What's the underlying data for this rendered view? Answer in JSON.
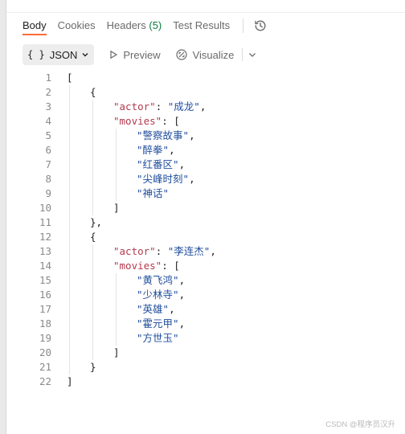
{
  "tabs": [
    {
      "label": "Body",
      "count": null,
      "active": true
    },
    {
      "label": "Cookies",
      "count": null,
      "active": false
    },
    {
      "label": "Headers",
      "count": "(5)",
      "active": false
    },
    {
      "label": "Test Results",
      "count": null,
      "active": false
    }
  ],
  "history_icon": "history-icon",
  "toolbar": {
    "format_braces": "{ }",
    "format_label": "JSON",
    "preview_label": "Preview",
    "visualize_label": "Visualize"
  },
  "editor": {
    "lines": [
      {
        "n": "1",
        "indent": 0,
        "parts": [
          {
            "t": "[",
            "c": "p"
          }
        ]
      },
      {
        "n": "2",
        "indent": 1,
        "parts": [
          {
            "t": "{",
            "c": "p"
          }
        ]
      },
      {
        "n": "3",
        "indent": 2,
        "parts": [
          {
            "t": "\"actor\"",
            "c": "k"
          },
          {
            "t": ": ",
            "c": "p"
          },
          {
            "t": "\"成龙\"",
            "c": "s"
          },
          {
            "t": ",",
            "c": "p"
          }
        ]
      },
      {
        "n": "4",
        "indent": 2,
        "parts": [
          {
            "t": "\"movies\"",
            "c": "k"
          },
          {
            "t": ": [",
            "c": "p"
          }
        ]
      },
      {
        "n": "5",
        "indent": 3,
        "parts": [
          {
            "t": "\"警察故事\"",
            "c": "s"
          },
          {
            "t": ",",
            "c": "p"
          }
        ]
      },
      {
        "n": "6",
        "indent": 3,
        "parts": [
          {
            "t": "\"醉拳\"",
            "c": "s"
          },
          {
            "t": ",",
            "c": "p"
          }
        ]
      },
      {
        "n": "7",
        "indent": 3,
        "parts": [
          {
            "t": "\"红番区\"",
            "c": "s"
          },
          {
            "t": ",",
            "c": "p"
          }
        ]
      },
      {
        "n": "8",
        "indent": 3,
        "parts": [
          {
            "t": "\"尖峰时刻\"",
            "c": "s"
          },
          {
            "t": ",",
            "c": "p"
          }
        ]
      },
      {
        "n": "9",
        "indent": 3,
        "parts": [
          {
            "t": "\"神话\"",
            "c": "s"
          }
        ]
      },
      {
        "n": "10",
        "indent": 2,
        "parts": [
          {
            "t": "]",
            "c": "p"
          }
        ]
      },
      {
        "n": "11",
        "indent": 1,
        "parts": [
          {
            "t": "},",
            "c": "p"
          }
        ]
      },
      {
        "n": "12",
        "indent": 1,
        "parts": [
          {
            "t": "{",
            "c": "p"
          }
        ]
      },
      {
        "n": "13",
        "indent": 2,
        "parts": [
          {
            "t": "\"actor\"",
            "c": "k"
          },
          {
            "t": ": ",
            "c": "p"
          },
          {
            "t": "\"李连杰\"",
            "c": "s"
          },
          {
            "t": ",",
            "c": "p"
          }
        ]
      },
      {
        "n": "14",
        "indent": 2,
        "parts": [
          {
            "t": "\"movies\"",
            "c": "k"
          },
          {
            "t": ": [",
            "c": "p"
          }
        ]
      },
      {
        "n": "15",
        "indent": 3,
        "parts": [
          {
            "t": "\"黄飞鸿\"",
            "c": "s"
          },
          {
            "t": ",",
            "c": "p"
          }
        ]
      },
      {
        "n": "16",
        "indent": 3,
        "parts": [
          {
            "t": "\"少林寺\"",
            "c": "s"
          },
          {
            "t": ",",
            "c": "p"
          }
        ]
      },
      {
        "n": "17",
        "indent": 3,
        "parts": [
          {
            "t": "\"英雄\"",
            "c": "s"
          },
          {
            "t": ",",
            "c": "p"
          }
        ]
      },
      {
        "n": "18",
        "indent": 3,
        "parts": [
          {
            "t": "\"霍元甲\"",
            "c": "s"
          },
          {
            "t": ",",
            "c": "p"
          }
        ]
      },
      {
        "n": "19",
        "indent": 3,
        "parts": [
          {
            "t": "\"方世玉\"",
            "c": "s"
          }
        ]
      },
      {
        "n": "20",
        "indent": 2,
        "parts": [
          {
            "t": "]",
            "c": "p"
          }
        ]
      },
      {
        "n": "21",
        "indent": 1,
        "parts": [
          {
            "t": "}",
            "c": "p"
          }
        ]
      },
      {
        "n": "22",
        "indent": 0,
        "parts": [
          {
            "t": "]",
            "c": "p"
          }
        ]
      }
    ]
  },
  "watermark": "CSDN @程序员汉升",
  "colors": {
    "accent": "#ff6c37",
    "json_key": "#b23b4e",
    "json_string": "#1f4e9c",
    "count": "#0a7c3e"
  }
}
